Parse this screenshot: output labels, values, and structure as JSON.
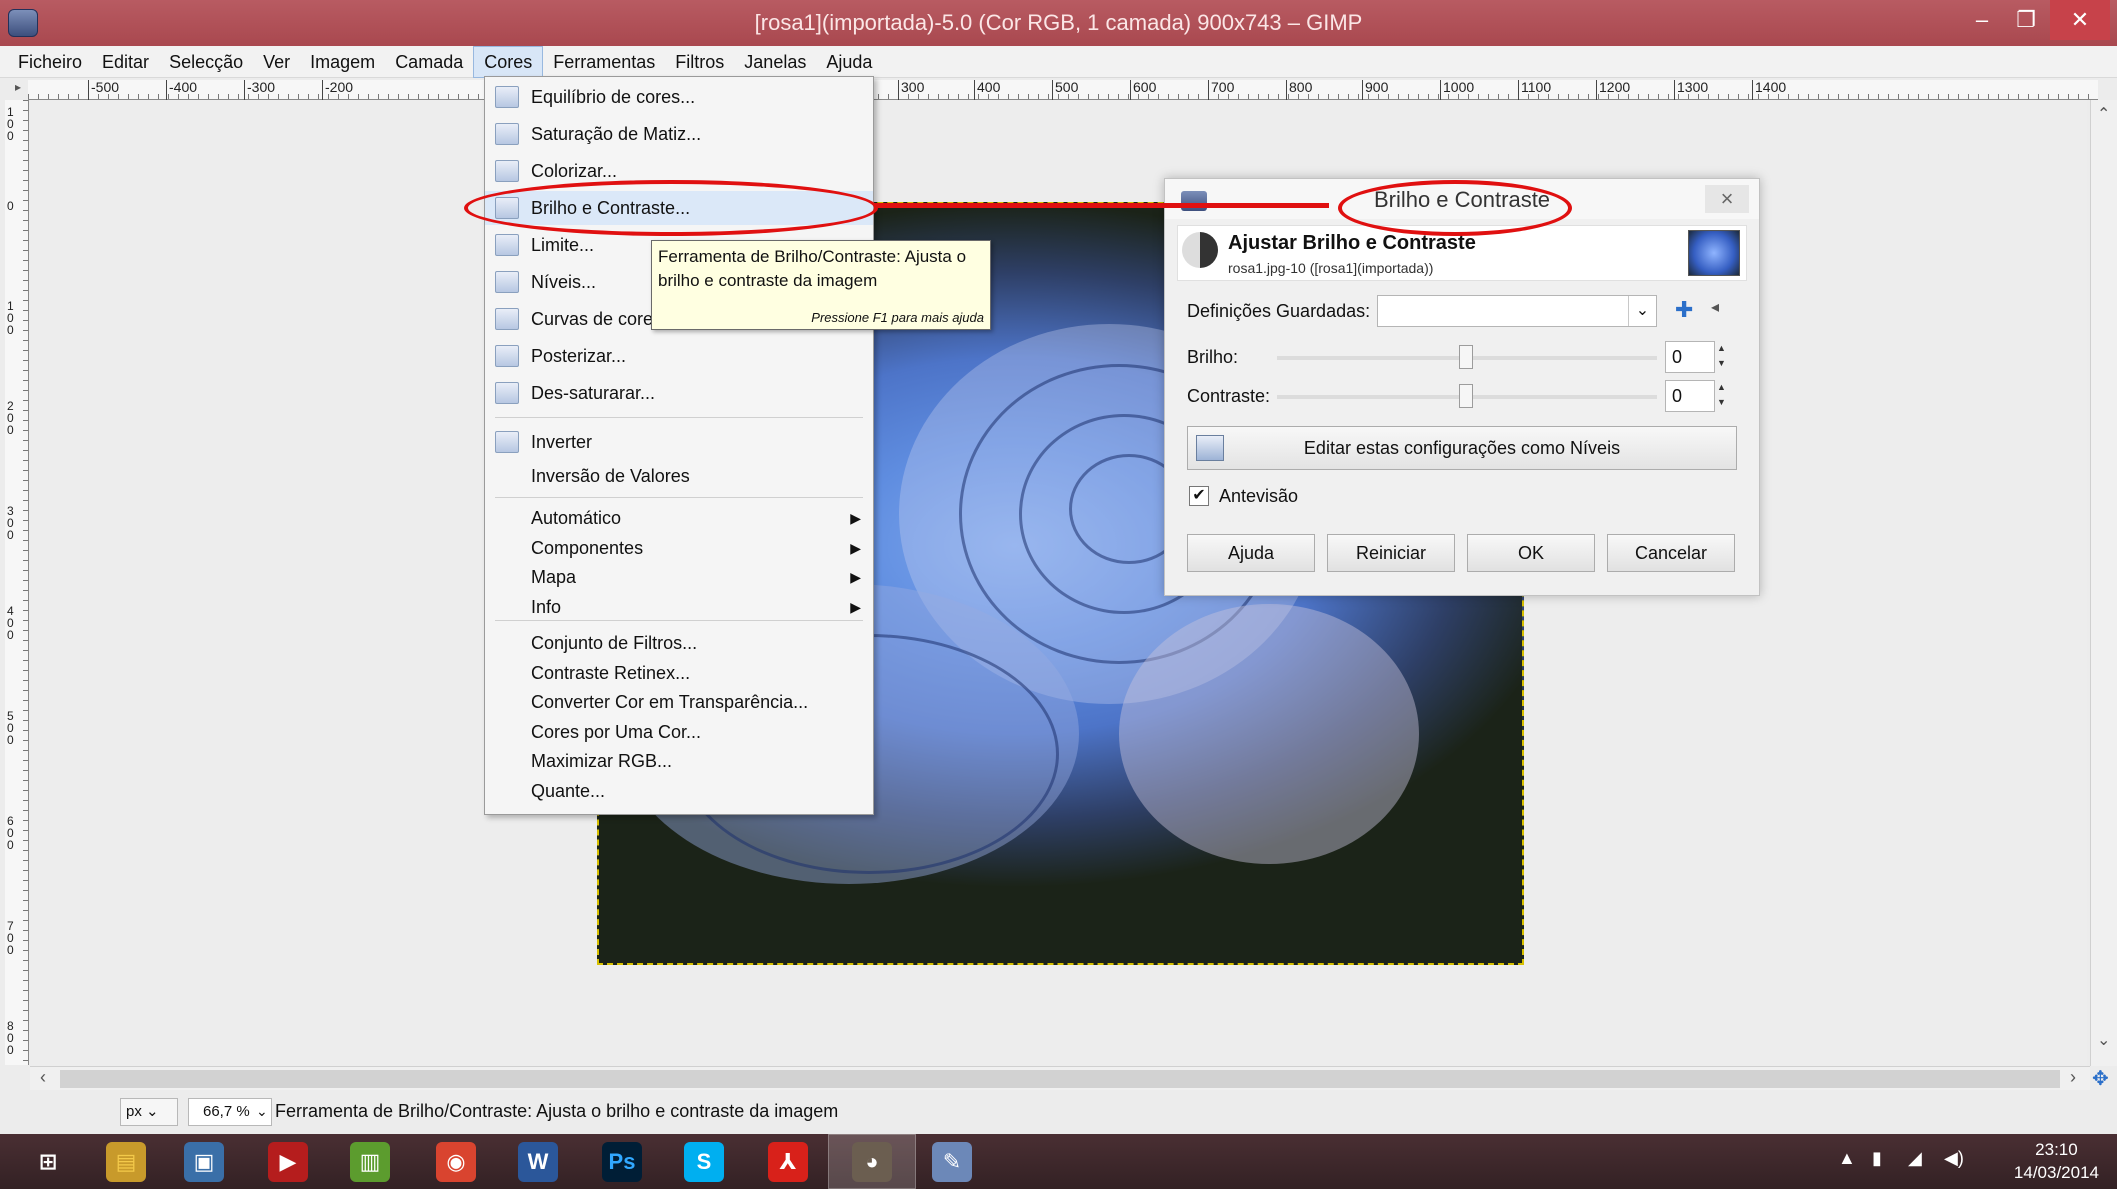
{
  "window": {
    "title": "[rosa1](importada)-5.0 (Cor RGB, 1 camada) 900x743 – GIMP",
    "min": "–",
    "restore": "❐",
    "close": "✕"
  },
  "menubar": [
    "Ficheiro",
    "Editar",
    "Selecção",
    "Ver",
    "Imagem",
    "Camada",
    "Cores",
    "Ferramentas",
    "Filtros",
    "Janelas",
    "Ajuda"
  ],
  "active_menu": "Cores",
  "ruler_top": [
    "-500",
    "-400",
    "-300",
    "-200",
    "300",
    "400",
    "500",
    "600",
    "700",
    "800",
    "900",
    "1000",
    "1100",
    "1200",
    "1300",
    "1400"
  ],
  "ruler_left": [
    "1 0 0",
    "0",
    "1 0 0",
    "2 0 0",
    "3 0 0",
    "4 0 0",
    "5 0 0",
    "6 0 0",
    "7 0 0",
    "8 0 0"
  ],
  "cores_menu": {
    "items": [
      {
        "label": "Equilíbrio de cores...",
        "icon": "color-balance-icon"
      },
      {
        "label": "Saturação de Matiz...",
        "icon": "hue-saturation-icon"
      },
      {
        "label": "Colorizar...",
        "icon": "colorize-icon"
      },
      {
        "label": "Brilho e Contraste...",
        "icon": "brightness-contrast-icon"
      },
      {
        "label": "Limite...",
        "icon": "threshold-icon"
      },
      {
        "label": "Níveis...",
        "icon": "levels-icon"
      },
      {
        "label": "Curvas de cores...",
        "icon": "curves-icon"
      },
      {
        "label": "Posterizar...",
        "icon": "posterize-icon"
      },
      {
        "label": "Des-saturarar...",
        "icon": "desaturate-icon"
      }
    ],
    "items2": [
      {
        "label": "Inverter",
        "icon": "invert-icon"
      },
      {
        "label": "Inversão de Valores",
        "icon": ""
      }
    ],
    "submenus": [
      "Automático",
      "Componentes",
      "Mapa",
      "Info"
    ],
    "items3": [
      "Conjunto de Filtros...",
      "Contraste Retinex...",
      "Converter Cor em Transparência...",
      "Cores por Uma Cor...",
      "Maximizar RGB...",
      "Quante..."
    ]
  },
  "tooltip": {
    "text": "Ferramenta de Brilho/Contraste: Ajusta o brilho e contraste da imagem",
    "hint": "Pressione F1 para mais ajuda"
  },
  "dialog": {
    "title": "Brilho e Contraste",
    "header": "Ajustar Brilho e Contraste",
    "subheader": "rosa1.jpg-10 ([rosa1](importada))",
    "saved_label": "Definições Guardadas:",
    "brightness_label": "Brilho:",
    "brightness_value": "0",
    "contrast_label": "Contraste:",
    "contrast_value": "0",
    "levels_button": "Editar estas configurações como Níveis",
    "preview_label": "Antevisão",
    "preview_checked": true,
    "buttons": {
      "help": "Ajuda",
      "reset": "Reiniciar",
      "ok": "OK",
      "cancel": "Cancelar"
    }
  },
  "statusbar": {
    "unit": "px",
    "zoom": "66,7 %",
    "message": "Ferramenta de Brilho/Contraste: Ajusta o brilho e contraste da imagem"
  },
  "taskbar": {
    "apps": [
      "start",
      "explorer",
      "remote",
      "media",
      "chart",
      "chrome",
      "word",
      "photoshop",
      "skype",
      "acrobat",
      "gimp",
      "paint"
    ],
    "time": "23:10",
    "date": "14/03/2014"
  },
  "colors": {
    "accent": "#e01010",
    "titlebar": "#b0515a",
    "highlight": "#dbe8f8"
  }
}
